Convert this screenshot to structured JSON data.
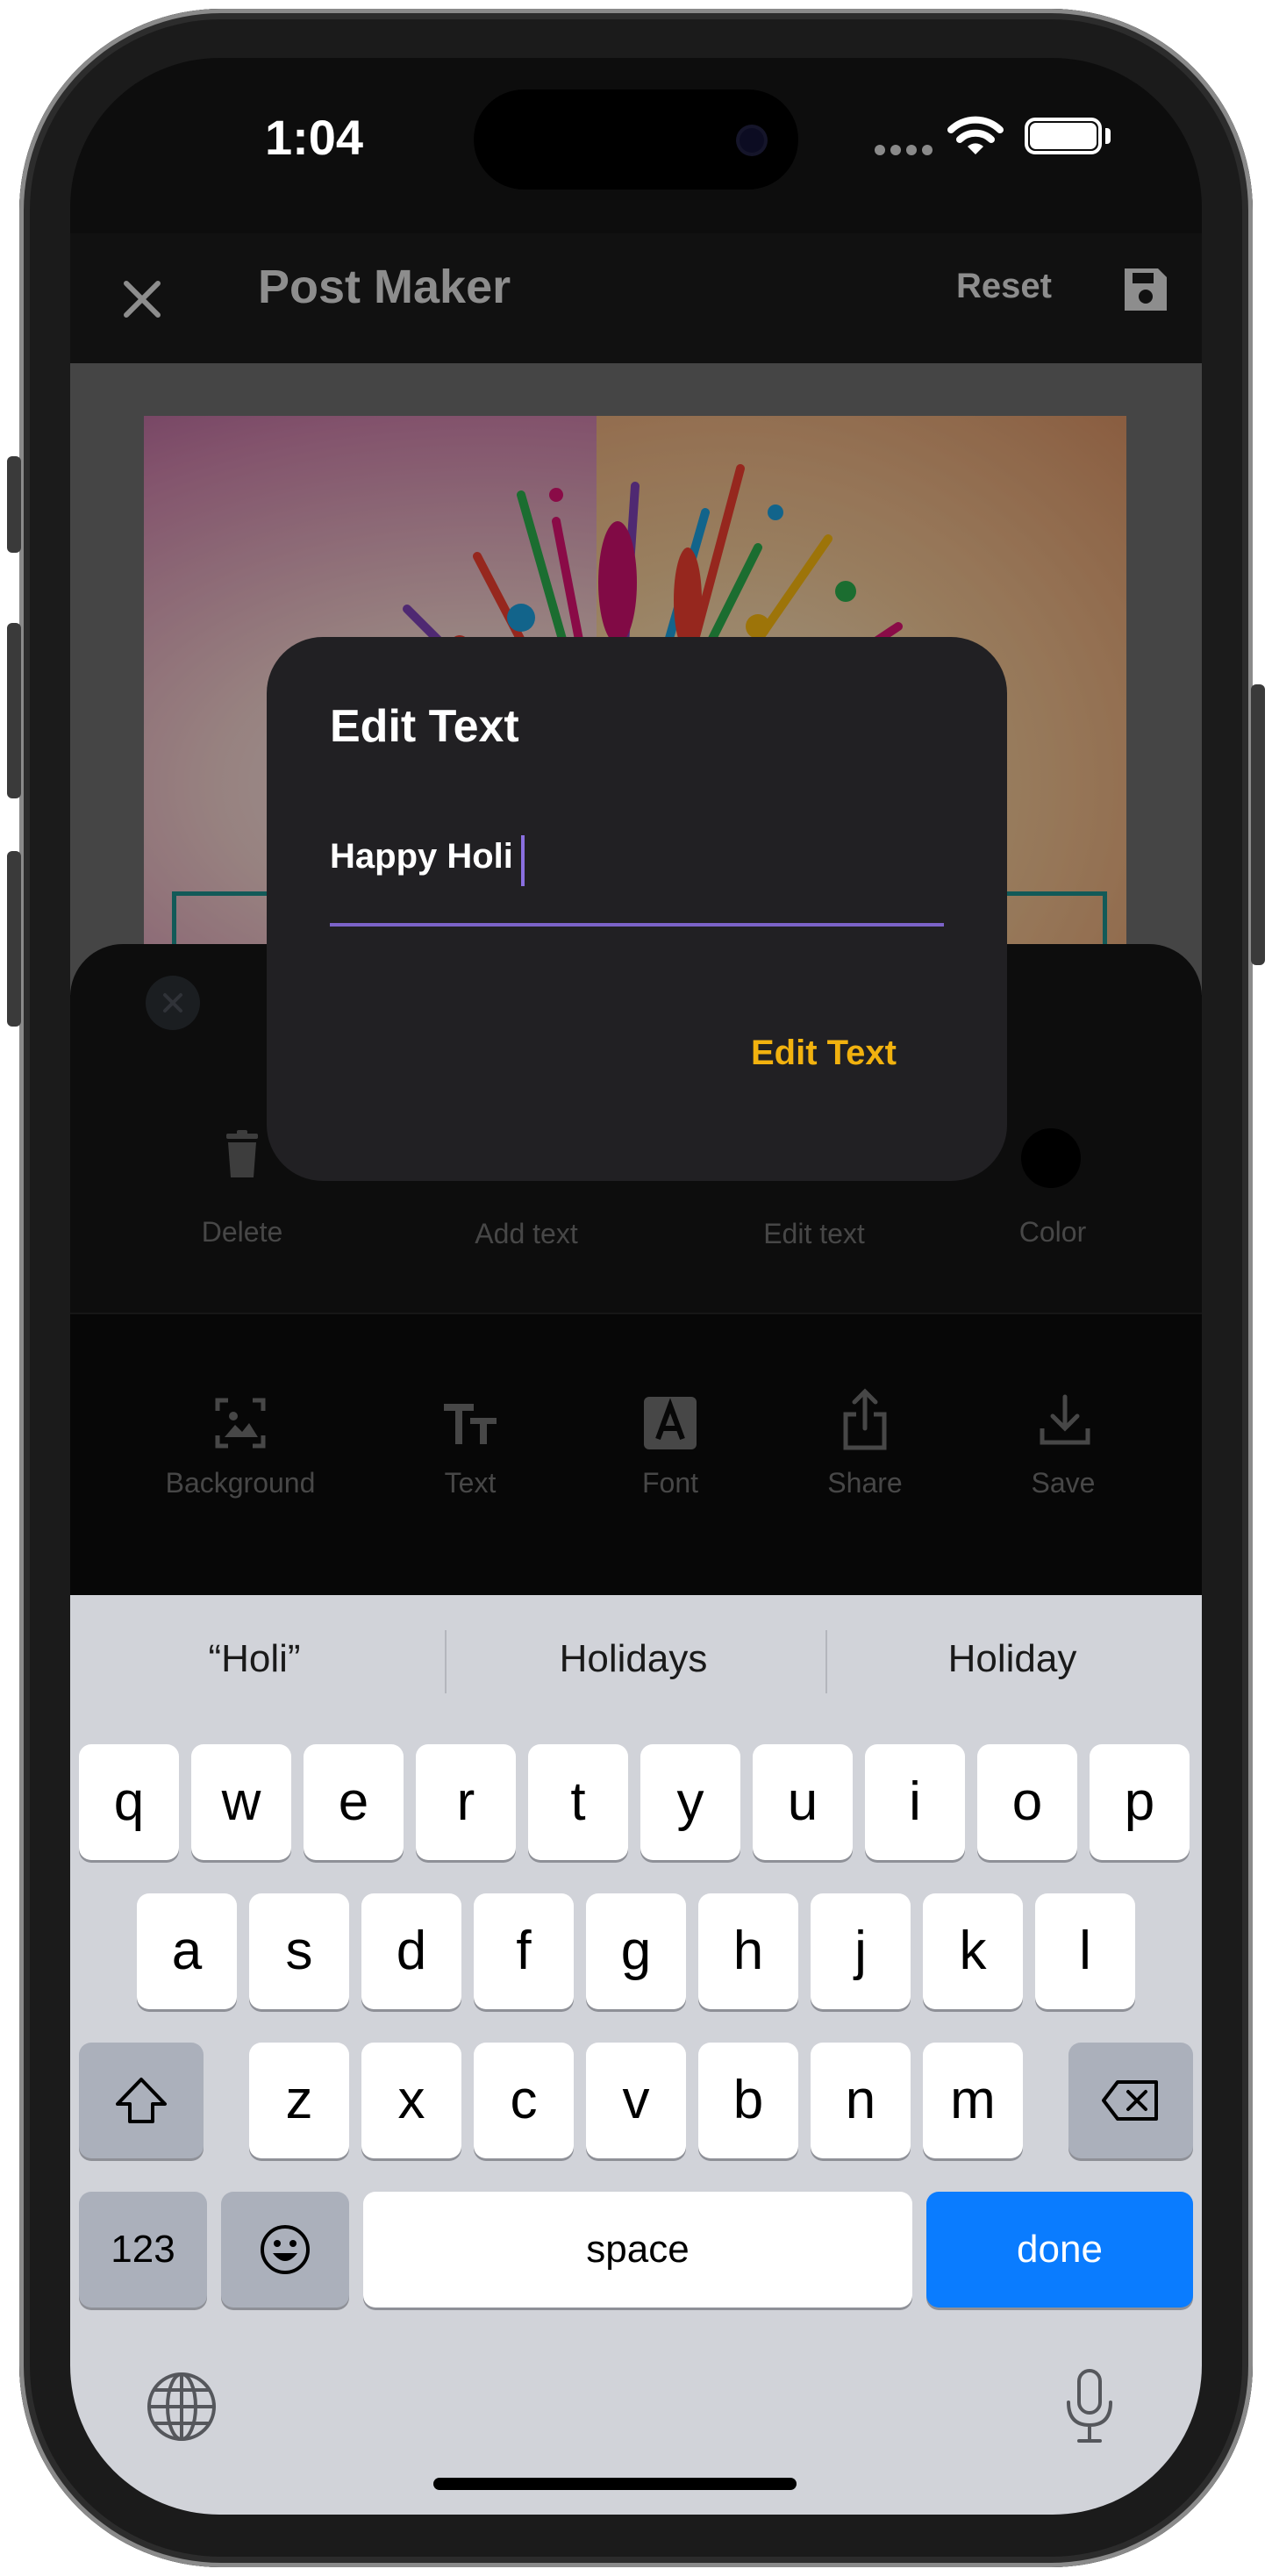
{
  "status_bar": {
    "time": "1:04"
  },
  "app_bar": {
    "title": "Post Maker",
    "reset_label": "Reset"
  },
  "tools": [
    {
      "label": "Delete",
      "icon": "trash-icon"
    },
    {
      "label": "Add text",
      "icon": "add-text-icon"
    },
    {
      "label": "Edit text",
      "icon": "edit-text-icon"
    },
    {
      "label": "Color",
      "icon": "color-swatch-icon"
    }
  ],
  "bottom_nav": [
    {
      "label": "Background",
      "icon": "image-icon"
    },
    {
      "label": "Text",
      "icon": "text-size-icon"
    },
    {
      "label": "Font",
      "icon": "font-icon"
    },
    {
      "label": "Share",
      "icon": "share-icon"
    },
    {
      "label": "Save",
      "icon": "download-icon"
    }
  ],
  "dialog": {
    "title": "Edit Text",
    "input_value": "Happy Holi",
    "action_label": "Edit Text"
  },
  "keyboard": {
    "suggestions": [
      "“Holi”",
      "Holidays",
      "Holiday"
    ],
    "row1": [
      "q",
      "w",
      "e",
      "r",
      "t",
      "y",
      "u",
      "i",
      "o",
      "p"
    ],
    "row2": [
      "a",
      "s",
      "d",
      "f",
      "g",
      "h",
      "j",
      "k",
      "l"
    ],
    "row3": [
      "z",
      "x",
      "c",
      "v",
      "b",
      "n",
      "m"
    ],
    "numbers_label": "123",
    "space_label": "space",
    "done_label": "done"
  },
  "colors": {
    "accent": "#7c63c9",
    "action": "#f2b20f",
    "done": "#0a7cff"
  }
}
